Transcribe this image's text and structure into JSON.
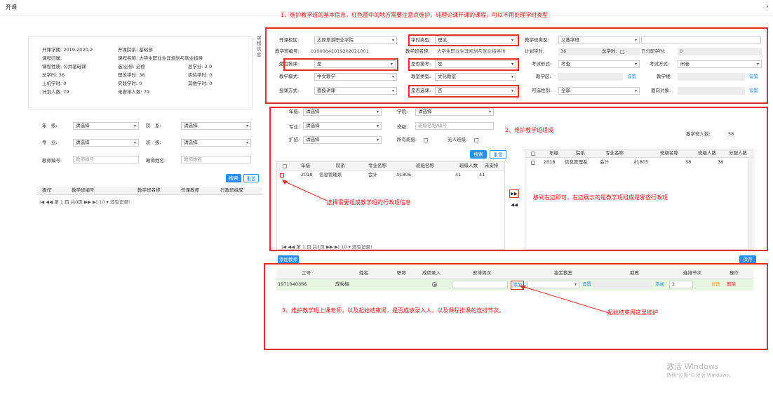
{
  "tab_title": "开课",
  "close_glyph": "›",
  "summary": {
    "term_label": "开课学期:",
    "term": "2019-2020-2",
    "dept_label": "开课院系:",
    "dept": "基础部",
    "belong_label": "课程归属:",
    "belong": "",
    "cname_label": "课程名称:",
    "cname": "大学生职业生涯规划与就业指导",
    "nature_label": "课程性质:",
    "nature": "公共基础课",
    "req_label": "选/必修:",
    "req": "必修",
    "credit_label": "总学分:",
    "credit": "2.0",
    "total_hours_label": "总学时:",
    "total_hours": "36",
    "theory_label": "理论学时:",
    "theory": "36",
    "exp_label": "实验学时:",
    "exp": "0",
    "comp_label": "上机学时:",
    "comp": "0",
    "prac_label": "实践学时:",
    "prac": "0",
    "other_label": "其他学时:",
    "other": "0",
    "plan_label": "计划人数:",
    "plan": "79",
    "unarranged_label": "未安排人数:",
    "unarranged": "79",
    "side_tab": "课程信息"
  },
  "left_filter": {
    "grade_label": "年　级:",
    "grade_val": "请选择",
    "college_label": "院　系:",
    "college_val": "请选择",
    "major_label": "专　业:",
    "major_val": "请选择",
    "class_label": "班　级:",
    "class_val": "请选择",
    "tid_label": "教师编号:",
    "tid_ph": "教师编号",
    "tname_label": "教师姓名:",
    "tname_ph": "教师姓名",
    "search": "搜索",
    "reset": "重置",
    "cols": [
      "操作",
      "教学班编号",
      "教学班名称",
      "任课教师",
      "行政班组成"
    ],
    "pager": "|◀  ◀◀  第 1    页  共0页  ▶▶  ▶|  10  ▾    没有记录!"
  },
  "annotations": {
    "note1": "1、维护教学班的基本信息，红色圈中的地方需要注意点维护，纯理论课开课的课程，可以不用处理学时类型",
    "note2": "2、维护教学班组成",
    "note_select": "选择需要组成教学班的行政班信息",
    "note_move": "移到右边即可，右边展示的是教学班组成是哪些行政班",
    "note3": "3、维护教学班上课老师，以及起始结束周，是否成绩录入人，以及课程排课的连排节次。",
    "note_week": "起始结束周这里维护"
  },
  "form": {
    "campus_label": "开课校区:",
    "campus": "太原旅游职业学院",
    "hourtype_label": "学时类型:",
    "hourtype": "理论",
    "classtype_label": "教学班类型:",
    "classtype": "父教学班",
    "code_label": "教学班编号:",
    "code": "01000842019202021001",
    "name_label": "教学班名称:",
    "name": "大学生职业生涯规划与就业指导(0",
    "plan_hours_label": "计划学时:",
    "plan_hours": "36",
    "total_label": "总学时:",
    "total": "",
    "assigned_label": "已分配学时:",
    "assigned": "0",
    "schedule_label": "是否排课:",
    "schedule": "是",
    "exam_label": "是否排考:",
    "exam": "是",
    "examform_label": "考试形式:",
    "examform": "考查",
    "exammode_label": "考试方式:",
    "exammode": "闭卷",
    "teachmode_label": "教学模式:",
    "teachmode": "中文教学",
    "room_label": "教室类型:",
    "room": "文化教室",
    "area_label": "教学区:",
    "area": "",
    "building_label": "教学楼:",
    "building": "",
    "method_label": "授课方式:",
    "method": "面授讲课",
    "elective_label": "是否选课:",
    "elective": "否",
    "gender_label": "可选性别:",
    "gender": "全部",
    "target_label": "面向对象:",
    "target": "",
    "set": "设置"
  },
  "composition": {
    "grade_label": "年级:",
    "grade_val": "请选择",
    "college_label": "学院:",
    "college_val": "请选择",
    "major_label": "专业:",
    "major_val": "请选择",
    "class_label": "班级:",
    "class_ph": "班级名称/编号",
    "level_label": "扩招:",
    "level_val": "请选择",
    "all_label": "所有班级:",
    "none_label": "无人班级:",
    "search": "搜索",
    "reset": "重置",
    "class_count_label": "教学班人数:",
    "class_count": "38",
    "left_cols": [
      "年级",
      "院系",
      "专业名称",
      "班级名称",
      "班级人数",
      "未安排"
    ],
    "left_row": [
      "2018",
      "信息管理系",
      "会计",
      "X1806",
      "41",
      "41"
    ],
    "right_cols": [
      "年级",
      "院系",
      "专业名称",
      "班级名称",
      "班级人数",
      "分配人数"
    ],
    "right_row": [
      "2018",
      "信息管理系",
      "会计",
      "X1805",
      "38",
      "38"
    ],
    "move_right": "▶▶",
    "move_left": "◀◀",
    "pager": "|◀  ◀◀  第 1   页  共1页  ▶▶  ▶|  10  ▾   没有记录!"
  },
  "teachers": {
    "add": "添加教师",
    "save": "保存",
    "cols": [
      "工号",
      "姓名",
      "职称",
      "成绩录入",
      "安排周次",
      "指定教室",
      "助教",
      "连排节次",
      "操作"
    ],
    "row": {
      "id": "1971040366",
      "name": "成秀梅",
      "weeks_add": "添加",
      "room_set": "设置",
      "assist_add": "添加",
      "span": "2",
      "edit": "修改",
      "del": "删除"
    }
  },
  "watermark": {
    "line1": "激活 Windows",
    "line2": "转到\"设置\"以激活 Windows。"
  },
  "colors": {
    "accent": "#2d8cf0",
    "annotation": "#e0201a"
  }
}
